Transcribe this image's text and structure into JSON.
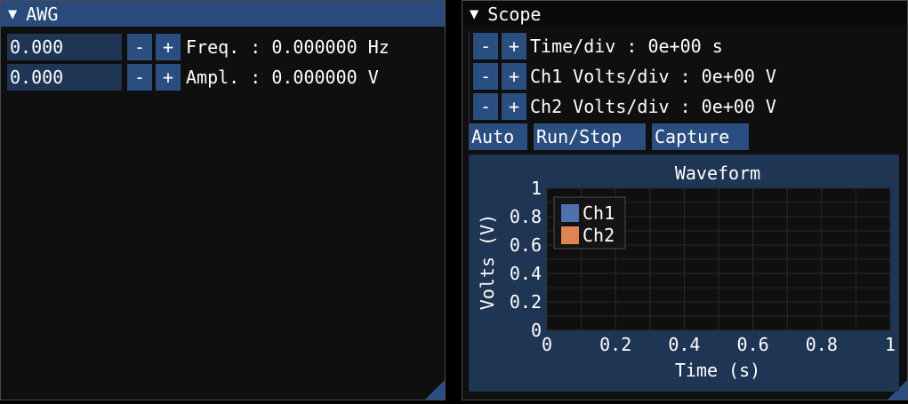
{
  "awg": {
    "title": "AWG",
    "freq": {
      "value": "0.000",
      "minus": "-",
      "plus": "+",
      "label": "Freq. : 0.000000 Hz"
    },
    "ampl": {
      "value": "0.000",
      "minus": "-",
      "plus": "+",
      "label": "Ampl. : 0.000000 V"
    }
  },
  "scope": {
    "title": "Scope",
    "time_div": {
      "minus": "-",
      "plus": "+",
      "label": "Time/div : 0e+00 s"
    },
    "ch1_div": {
      "minus": "-",
      "plus": "+",
      "label": "Ch1 Volts/div : 0e+00 V"
    },
    "ch2_div": {
      "minus": "-",
      "plus": "+",
      "label": "Ch2 Volts/div : 0e+00 V"
    },
    "buttons": {
      "auto": "Auto",
      "run_stop": "Run/Stop",
      "capture": "Capture"
    }
  },
  "colors": {
    "ch1": "#4c72b0",
    "ch2": "#dd8452",
    "accent": "#2a4e7f",
    "plot_bg": "#1e3553"
  },
  "icons": {
    "collapse": "triangle-down-icon",
    "resize": "resize-grip-icon"
  },
  "chart_data": {
    "type": "line",
    "title": "Waveform",
    "xlabel": "Time (s)",
    "ylabel": "Volts (V)",
    "xlim": [
      0,
      1
    ],
    "ylim": [
      0,
      1
    ],
    "xticks": [
      "0",
      "0.2",
      "0.4",
      "0.6",
      "0.8",
      "1"
    ],
    "yticks": [
      "0",
      "0.2",
      "0.4",
      "0.6",
      "0.8",
      "1"
    ],
    "grid": true,
    "legend": "top-left",
    "series": [
      {
        "name": "Ch1",
        "x": [],
        "y": []
      },
      {
        "name": "Ch2",
        "x": [],
        "y": []
      }
    ]
  }
}
